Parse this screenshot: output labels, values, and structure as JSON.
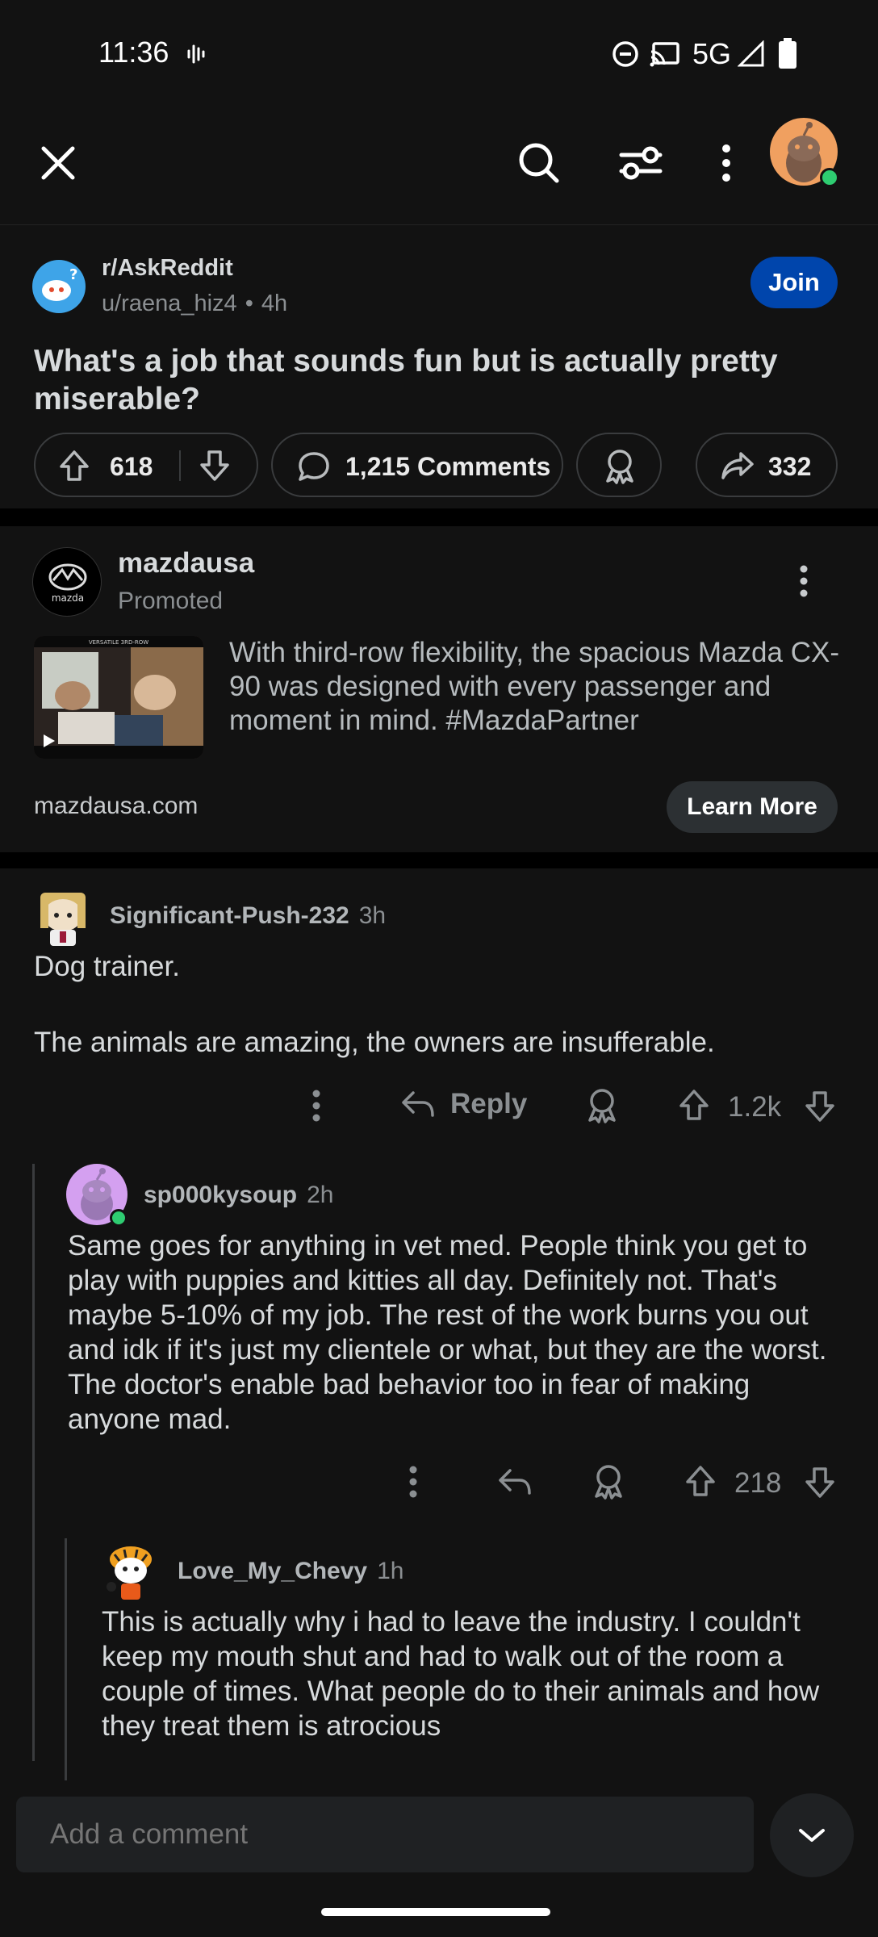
{
  "status_bar": {
    "time": "11:36",
    "network": "5G"
  },
  "post": {
    "subreddit": "r/AskReddit",
    "author": "u/raena_hiz4",
    "age": "4h",
    "join_label": "Join",
    "title": "What's a job that sounds fun but is actually pretty miserable?",
    "score": "618",
    "comments_label": "1,215 Comments",
    "shares": "332"
  },
  "ad": {
    "advertiser": "mazdausa",
    "badge": "Promoted",
    "logo_text": "mazda",
    "thumb_caption": "VERSATILE 3RD-ROW",
    "body": "With third-row flexibility, the spacious Mazda CX-90 was designed with every passenger and moment in mind. #MazdaPartner",
    "domain": "mazdausa.com",
    "cta": "Learn More"
  },
  "comments": [
    {
      "author": "Significant-Push-232",
      "age": "3h",
      "body_line1": "Dog trainer.",
      "body_line2": "The animals are amazing, the owners are insufferable.",
      "reply_label": "Reply",
      "score": "1.2k"
    },
    {
      "author": "sp000kysoup",
      "age": "2h",
      "body": "Same goes for anything in vet med. People think you get to play with puppies and kitties all day. Definitely not. That's maybe 5-10% of my job. The rest of the work burns you out and idk if it's just my clientele or what, but they are the worst. The doctor's enable bad behavior too in fear of making anyone mad.",
      "score": "218"
    },
    {
      "author": "Love_My_Chevy",
      "age": "1h",
      "body": "This is actually why i had to leave the industry. I couldn't keep my mouth shut and had to walk out of the room a couple of times. What people do to their animals and how they treat them is atrocious"
    }
  ],
  "comment_box": {
    "placeholder": "Add a comment"
  },
  "colors": {
    "accent": "#0045ac",
    "online": "#2ecc71",
    "background": "#121212"
  }
}
